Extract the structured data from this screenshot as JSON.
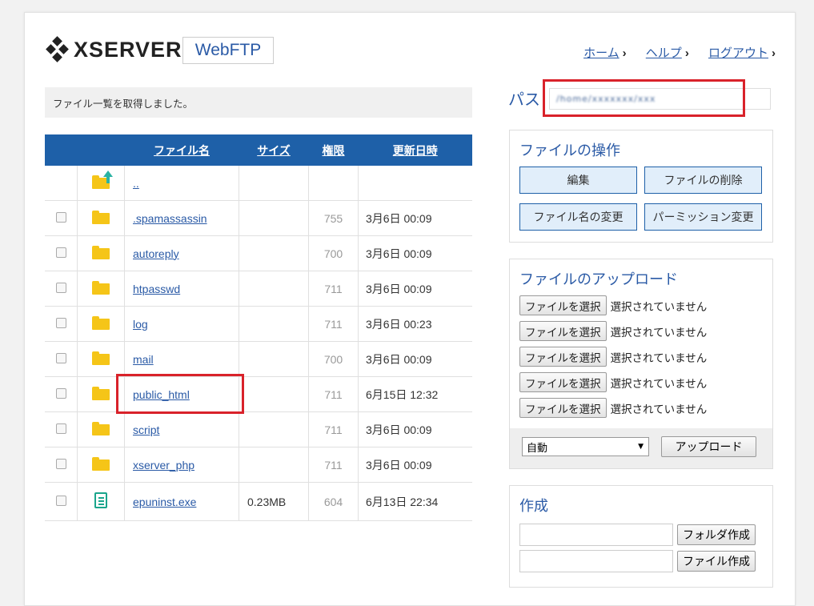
{
  "header": {
    "logo_text": "XSERVER",
    "app_name": "WebFTP",
    "nav": [
      {
        "label": "ホーム"
      },
      {
        "label": "ヘルプ"
      },
      {
        "label": "ログアウト"
      }
    ]
  },
  "message": "ファイル一覧を取得しました。",
  "table": {
    "headers": {
      "name": "ファイル名",
      "size": "サイズ",
      "perm": "権限",
      "date": "更新日時"
    },
    "rows": [
      {
        "icon": "parent-folder-icon",
        "name": "..",
        "size": "",
        "perm": "",
        "date": ""
      },
      {
        "icon": "folder-icon",
        "name": ".spamassassin",
        "size": "",
        "perm": "755",
        "date": "3月6日 00:09"
      },
      {
        "icon": "folder-icon",
        "name": "autoreply",
        "size": "",
        "perm": "700",
        "date": "3月6日 00:09"
      },
      {
        "icon": "folder-icon",
        "name": "htpasswd",
        "size": "",
        "perm": "711",
        "date": "3月6日 00:09"
      },
      {
        "icon": "folder-icon",
        "name": "log",
        "size": "",
        "perm": "711",
        "date": "3月6日 00:23"
      },
      {
        "icon": "folder-icon",
        "name": "mail",
        "size": "",
        "perm": "700",
        "date": "3月6日 00:09"
      },
      {
        "icon": "folder-icon",
        "name": "public_html",
        "size": "",
        "perm": "711",
        "date": "6月15日 12:32"
      },
      {
        "icon": "folder-icon",
        "name": "script",
        "size": "",
        "perm": "711",
        "date": "3月6日 00:09"
      },
      {
        "icon": "folder-icon",
        "name": "xserver_php",
        "size": "",
        "perm": "711",
        "date": "3月6日 00:09"
      },
      {
        "icon": "file-icon",
        "name": "epuninst.exe",
        "size": "0.23MB",
        "perm": "604",
        "date": "6月13日 22:34"
      }
    ]
  },
  "path": {
    "label": "パス",
    "value": "/home/xxxxxxx/xxx"
  },
  "operations": {
    "title": "ファイルの操作",
    "edit": "編集",
    "delete": "ファイルの削除",
    "rename": "ファイル名の変更",
    "permission": "パーミッション変更"
  },
  "upload": {
    "title": "ファイルのアップロード",
    "choose_label": "ファイルを選択",
    "no_file_label": "選択されていません",
    "mode_selected": "自動",
    "upload_button": "アップロード"
  },
  "create": {
    "title": "作成",
    "folder_button": "フォルダ作成",
    "file_button": "ファイル作成"
  },
  "colors": {
    "accent": "#1e60a8",
    "highlight": "#d9222a",
    "folder": "#f5c518"
  }
}
